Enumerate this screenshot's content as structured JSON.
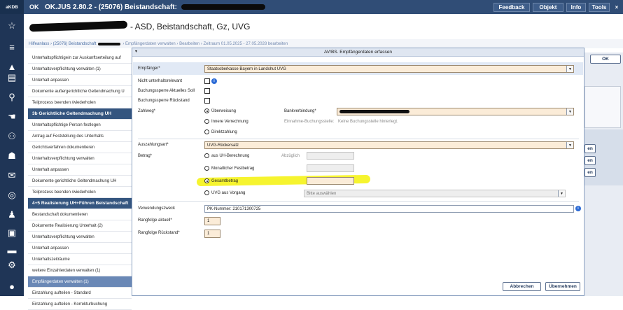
{
  "app": {
    "brand": "aKDB",
    "logo": "OK",
    "title": "OK.JUS 2.80.2 - (25076) Beistandschaft:"
  },
  "toolbar": {
    "feedback": "Feedback",
    "objekt": "Objekt",
    "info": "Info",
    "tools": "Tools",
    "close": "×"
  },
  "heading": {
    "text": "- ASD, Beistandschaft, Gz, UVG"
  },
  "breadcrumb": {
    "link": "Hilfeanlass › (25076) Beistandschaft",
    "rest": "› Empfängerdaten verwalten › Bearbeiten › Zeitraum 01.05.2025 - 27.05.2028 bearbeiten"
  },
  "sidebar": {
    "items": [
      {
        "label": "Unterhaltspflichtige/n zur Auskunftserteilung auf"
      },
      {
        "label": "Unterhaltsverpflichtung verwalten (1)"
      },
      {
        "label": "Unterhalt anpassen"
      },
      {
        "label": "Dokumente außergerichtliche Geltendmachung U"
      },
      {
        "label": "Teilprozess beenden /wiederholen"
      },
      {
        "label": "3b Gerichtliche Geltendmachung UH"
      },
      {
        "label": "Unterhaltspflichtige Person festlegen"
      },
      {
        "label": "Antrag auf Feststellung des Unterhalts"
      },
      {
        "label": "Gerichtsverfahren dokumentieren"
      },
      {
        "label": "Unterhaltsverpflichtung verwalten"
      },
      {
        "label": "Unterhalt anpassen"
      },
      {
        "label": "Dokumente gerichtliche Geltendmachung UH"
      },
      {
        "label": "Teilprozess beenden /wiederholen"
      },
      {
        "label": "4+5 Realisierung UH+Führen Beistandschaft"
      },
      {
        "label": "Bestandschaft dokumentieren"
      },
      {
        "label": "Dokumente Realisierung Unterhalt (2)"
      },
      {
        "label": "Unterhaltsverpflichtung verwalten"
      },
      {
        "label": "Unterhalt anpassen"
      },
      {
        "label": "Unterhaltszeiträume"
      },
      {
        "label": "weitere Einzahlerdaten verwalten (1)"
      },
      {
        "label": "Empfängerdaten verwalten (1)"
      },
      {
        "label": "Einzahlung aufteilen - Standard"
      },
      {
        "label": "Einzahlung aufteilen - Korrekturbuchung"
      }
    ]
  },
  "right": {
    "ok": "OK",
    "b1": "en",
    "b2": "en",
    "b3": "en"
  },
  "dialog": {
    "title": "AV/BS. Empfängerdaten erfassen",
    "empfaenger_label": "Empfänger*",
    "empfaenger_value": "Staatsoberkasse Bayern in Landshut UVG",
    "nicht_label": "Nicht unterhaltsrelevant",
    "sperre_soll_label": "Buchungssperre Aktuelles Soll",
    "sperre_rueck_label": "Buchungssperre Rückstand",
    "zahlweg_label": "Zahlweg*",
    "zahlweg_options": [
      "Überweisung",
      "Innere Verrechnung",
      "Direktzahlung"
    ],
    "bank_label": "Bankverbindung*",
    "einnahme_label": "Einnahme-Buchungsstelle:",
    "einnahme_value": "Keine Buchungsstelle hinterlegt.",
    "auszahlung_label": "Auszahlungsart*",
    "auszahlung_value": "UVG-Rückersatz",
    "betrag_label": "Betrag*",
    "betrag_options": [
      "aus UH-Berechnung",
      "Monatlicher Festbetrag",
      "Gesamtbetrag",
      "UVG aus Vorgang"
    ],
    "abzueglich_label": "Abzüglich",
    "uvg_placeholder": "Bitte auswählen",
    "vz_label": "Verwendungszweck",
    "vz_value": "PK-Nummer: 210171300725",
    "rang_aktuell_label": "Rangfolge aktuell*",
    "rang_aktuell_value": "1",
    "rang_rueck_label": "Rangfolge Rückstand*",
    "rang_rueck_value": "1",
    "cancel": "Abbrechen",
    "accept": "Übernehmen"
  },
  "colors": {
    "header": "#304d76",
    "rail": "#1f3556",
    "group": "#34557f",
    "required": "#fbecd8",
    "highlight": "#f5f20a"
  },
  "icons": [
    "star-icon",
    "menu-icon",
    "home-icon",
    "document-icon",
    "search-money-icon",
    "hand-icon",
    "people-icon",
    "pair-icon",
    "mail-icon",
    "target-icon",
    "person-icon",
    "notes-icon",
    "chevron-icon",
    "settings-icon",
    "user-icon",
    "info-icon",
    "dropdown-icon"
  ]
}
